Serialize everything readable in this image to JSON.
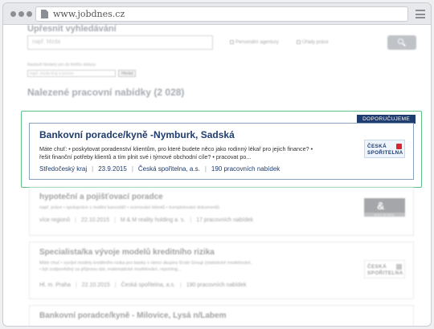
{
  "browser": {
    "url": "www.jobdnes.cz"
  },
  "filters": {
    "heading": "Upřesnit vyhledávání",
    "search_placeholder": "např. Mzda",
    "option_agency": "Personální agentury",
    "option_labor_office": "Úřady práce",
    "salary_text": "Nastavit hledaný pro do třetího dotazu:",
    "salary_placeholder": "např. mzda kraj a pozice",
    "salary_button": "Hledat"
  },
  "results": {
    "heading": "Nalezené pracovní nabídky (2 028)"
  },
  "featured": {
    "badge": "DOPORUČUJEME",
    "title": "Bankovní poradce/kyně -Nymburk, Sadská",
    "desc_line1": "Máte chuť: • poskytovat poradenství klientům, pro které budete něco jako rodinný lékař pro jejich finance? •",
    "desc_line2": "řešit finanční potřeby klientů a tím plnit své i týmové obchodní cíle? • pracovat po...",
    "region": "Středočeský kraj",
    "date": "23.9.2015",
    "company": "Česká spořitelna, a.s.",
    "count": "190 pracovních nabídek",
    "logo_line1": "ČESKÁ",
    "logo_line2": "SPOŘITELNA"
  },
  "listings": [
    {
      "title": "hypoteční a pojišťovací poradce",
      "desc_line1": "např. práce • spolupráce s realitní kanceláří • ocenování klientů • kompletování dokumentů",
      "desc_line2": "",
      "region": "více regionů",
      "date": "22.10.2015",
      "company": "M & M reality holding a. s.",
      "count": "17 pracovních nabídek",
      "logo_line1": "&",
      "logo_line2": "HOLDING"
    },
    {
      "title": "Specialista/ka vývoje modelů kreditního rizika",
      "desc_line1": "Máte chuť • vyvíjet modely kreditního rizika pro banky v rámci skupiny Erste Group (statistické modelování,",
      "desc_line2": "• být zodpovědný za přípravu dat, matematické modelování, reporting...",
      "region": "Hl. m. Praha",
      "date": "22.10.2015",
      "company": "Česká spořitelna, a.s.",
      "count": "190 pracovních nabídek",
      "logo_line1": "ČESKÁ",
      "logo_line2": "SPOŘITELNA"
    },
    {
      "title": "Bankovní poradce/kyně - Milovice, Lysá n/Labem"
    }
  ]
}
